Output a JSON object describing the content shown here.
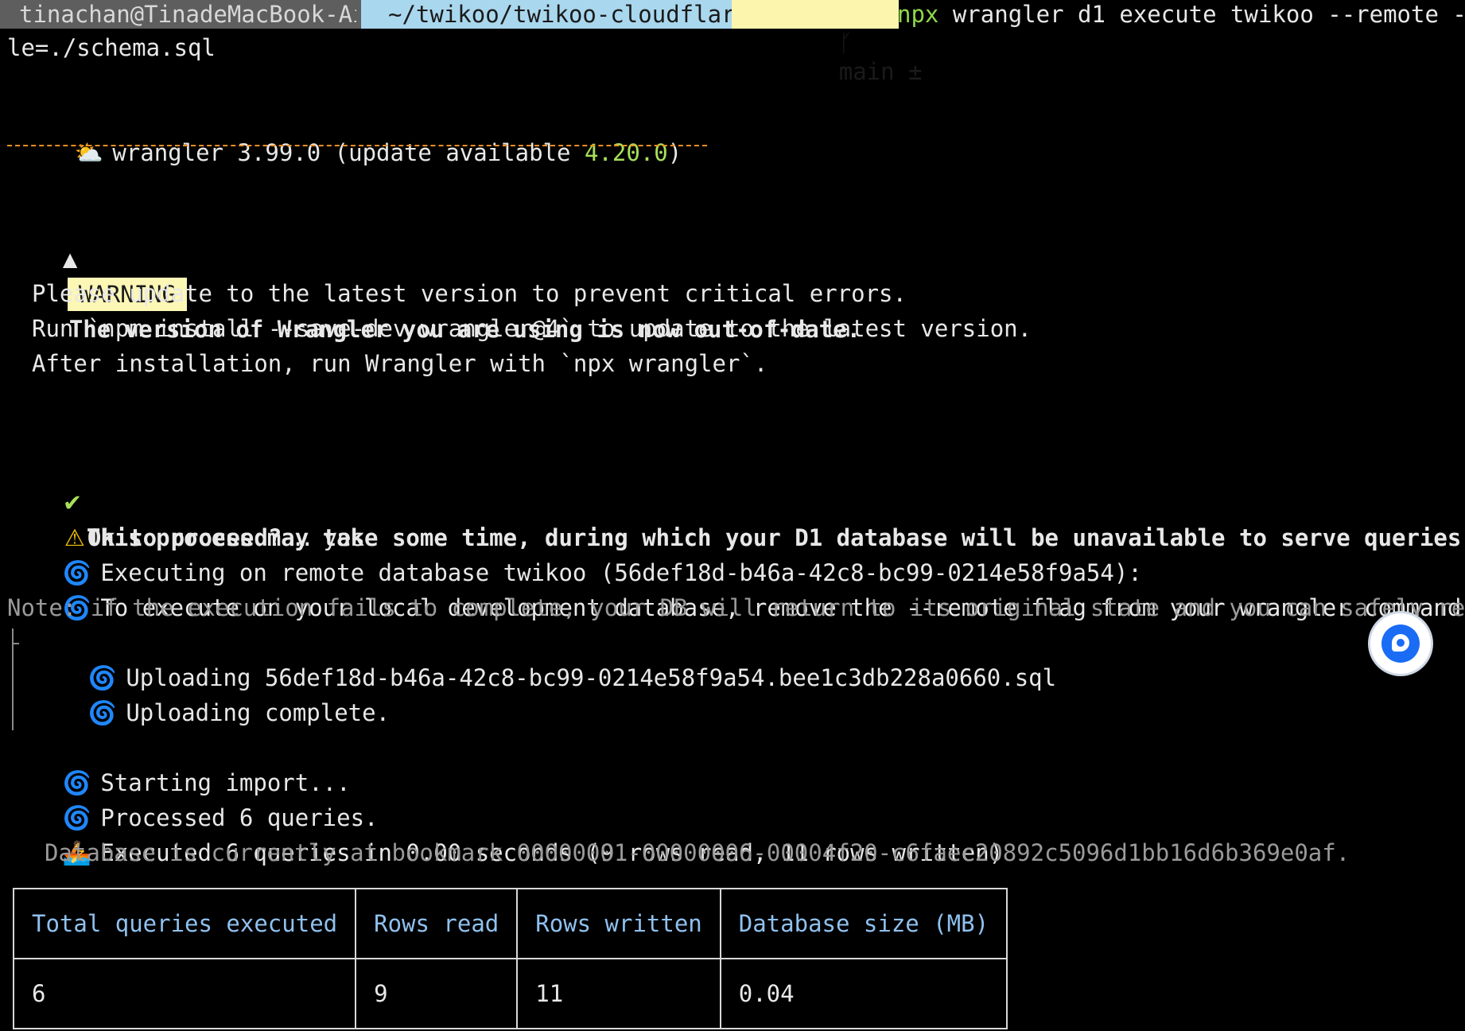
{
  "prompt": {
    "user_host": "tinachan@TinadeMacBook-Air",
    "path": "~/twikoo/twikoo-cloudflare",
    "branch_icon": "git-branch-icon",
    "branch": "main ±",
    "command_prefix": "npx",
    "command_rest": " wrangler d1 execute twikoo --remote --fi",
    "command_wrap": "le=./schema.sql",
    "colors": {
      "user_bg": "#5e5e5e",
      "path_bg": "#a9d7ee",
      "branch_bg": "#fcf5ae"
    }
  },
  "version_line": {
    "icon": "sun-behind-cloud-icon",
    "text": "wrangler 3.99.0 (update available ",
    "new_version": "4.20.0",
    "close": ")"
  },
  "warning": {
    "icon": "warning-triangle-icon",
    "badge": "WARNING",
    "title": "The version of Wrangler you are using is now out-of-date.",
    "lines": [
      "Please update to the latest version to prevent critical errors.",
      "Run `npm install --save-dev wrangler@4` to update to the latest version.",
      "After installation, run Wrangler with `npx wrangler`."
    ]
  },
  "confirm": {
    "check_icon": "checkmark-icon",
    "warn_icon": "warning-emoji-icon",
    "message": "This process may take some time, during which your D1 database will be unavailable to serve queries.",
    "question": "Ok to proceed?",
    "answer": " … yes"
  },
  "log": {
    "executing": "Executing on remote database twikoo (56def18d-b46a-42c8-bc99-0214e58f9a54):",
    "local_hint": "To execute on your local development database, remove the --remote flag from your wrangler command.",
    "note": "Note: if the execution fails to complete, your DB will return to its original state and you can safely retry.",
    "uploading": "Uploading 56def18d-b46a-42c8-bc99-0214e58f9a54.bee1c3db228a0660.sql",
    "upload_complete": "Uploading complete.",
    "starting": "Starting import...",
    "processed": "Processed 6 queries.",
    "executed": "Executed 6 queries in 0.00 seconds (9 rows read, 11 rows written)",
    "bookmark": "Database is currently at bookmark 00000001-00000006-00004f20-c6faec20892c5096d1bb16d6b369e0af.",
    "spiral_icon": "cyclone-icon",
    "rowboat_icon": "rowboat-icon"
  },
  "table": {
    "headers": [
      "Total queries executed",
      "Rows read",
      "Rows written",
      "Database size (MB)"
    ],
    "rows": [
      [
        "6",
        "9",
        "11",
        "0.04"
      ]
    ]
  },
  "widgets": {
    "help_bubble_icon": "chat-bubble-icon"
  }
}
